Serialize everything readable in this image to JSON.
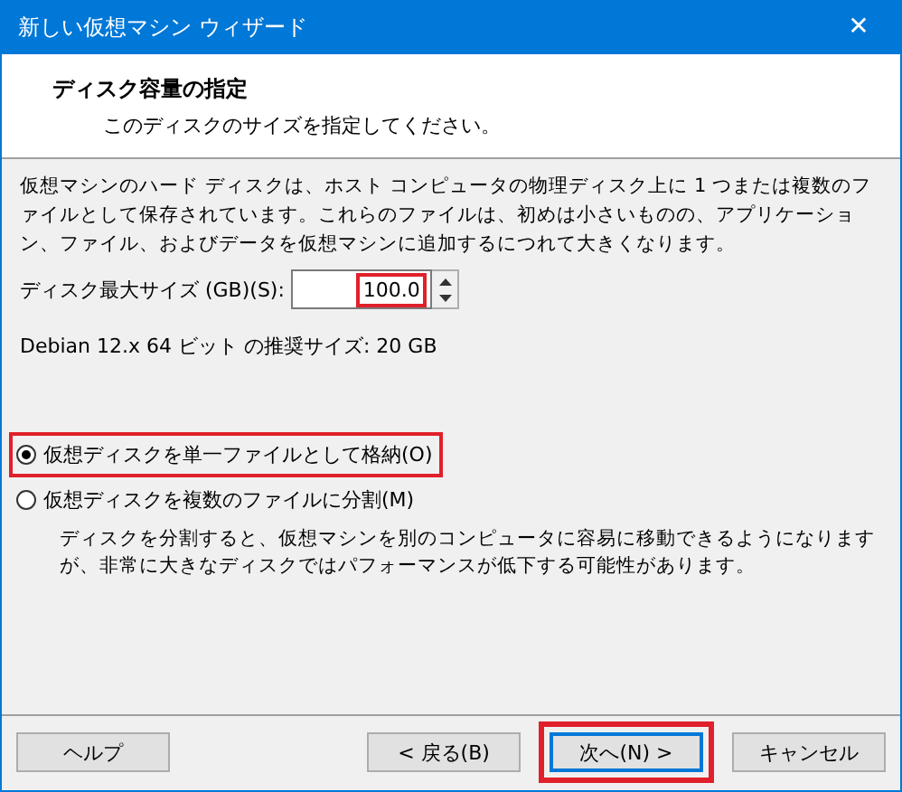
{
  "window": {
    "title": "新しい仮想マシン ウィザード",
    "close": "✕"
  },
  "header": {
    "title": "ディスク容量の指定",
    "subtitle": "このディスクのサイズを指定してください。"
  },
  "description": "仮想マシンのハード ディスクは、ホスト コンピュータの物理ディスク上に 1 つまたは複数のファイルとして保存されています。これらのファイルは、初めは小さいものの、アプリケーション、ファイル、およびデータを仮想マシンに追加するにつれて大きくなります。",
  "disk_size": {
    "label": "ディスク最大サイズ (GB)(S):",
    "value": "100.0",
    "highlighted": true
  },
  "recommended": "Debian 12.x 64 ビット の推奨サイズ: 20 GB",
  "options": [
    {
      "label": "仮想ディスクを単一ファイルとして格納(O)",
      "selected": true,
      "highlighted": true
    },
    {
      "label": "仮想ディスクを複数のファイルに分割(M)",
      "selected": false,
      "highlighted": false,
      "note": "ディスクを分割すると、仮想マシンを別のコンピュータに容易に移動できるようになりますが、非常に大きなディスクではパフォーマンスが低下する可能性があります。"
    }
  ],
  "buttons": [
    {
      "label": "ヘルプ",
      "kind": "help",
      "default": false,
      "highlighted": false
    },
    {
      "label": "< 戻る(B)",
      "kind": "nav",
      "default": false,
      "highlighted": false
    },
    {
      "label": "次へ(N) >",
      "kind": "nav",
      "default": true,
      "highlighted": true
    },
    {
      "label": "キャンセル",
      "kind": "nav",
      "default": false,
      "highlighted": false
    }
  ]
}
